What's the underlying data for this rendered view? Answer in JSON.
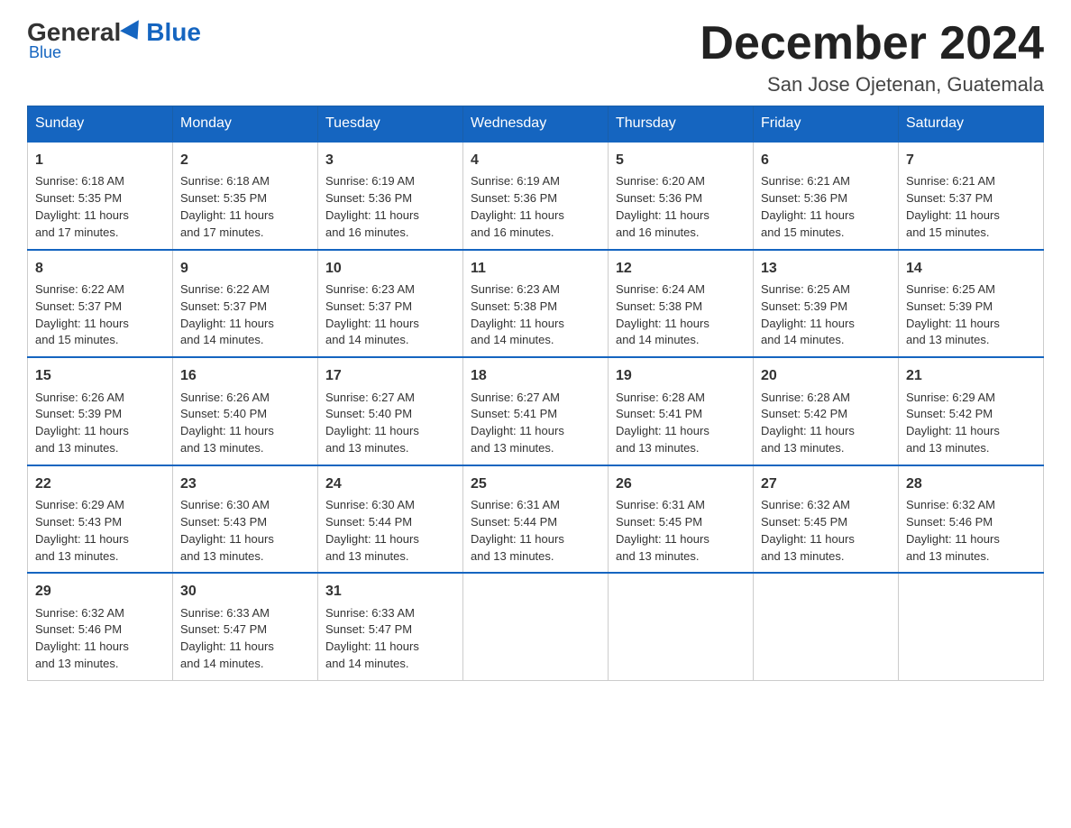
{
  "logo": {
    "general": "General",
    "blue": "Blue"
  },
  "title": "December 2024",
  "subtitle": "San Jose Ojetenan, Guatemala",
  "days": [
    "Sunday",
    "Monday",
    "Tuesday",
    "Wednesday",
    "Thursday",
    "Friday",
    "Saturday"
  ],
  "weeks": [
    [
      {
        "num": "1",
        "sunrise": "6:18 AM",
        "sunset": "5:35 PM",
        "daylight": "11 hours and 17 minutes."
      },
      {
        "num": "2",
        "sunrise": "6:18 AM",
        "sunset": "5:35 PM",
        "daylight": "11 hours and 17 minutes."
      },
      {
        "num": "3",
        "sunrise": "6:19 AM",
        "sunset": "5:36 PM",
        "daylight": "11 hours and 16 minutes."
      },
      {
        "num": "4",
        "sunrise": "6:19 AM",
        "sunset": "5:36 PM",
        "daylight": "11 hours and 16 minutes."
      },
      {
        "num": "5",
        "sunrise": "6:20 AM",
        "sunset": "5:36 PM",
        "daylight": "11 hours and 16 minutes."
      },
      {
        "num": "6",
        "sunrise": "6:21 AM",
        "sunset": "5:36 PM",
        "daylight": "11 hours and 15 minutes."
      },
      {
        "num": "7",
        "sunrise": "6:21 AM",
        "sunset": "5:37 PM",
        "daylight": "11 hours and 15 minutes."
      }
    ],
    [
      {
        "num": "8",
        "sunrise": "6:22 AM",
        "sunset": "5:37 PM",
        "daylight": "11 hours and 15 minutes."
      },
      {
        "num": "9",
        "sunrise": "6:22 AM",
        "sunset": "5:37 PM",
        "daylight": "11 hours and 14 minutes."
      },
      {
        "num": "10",
        "sunrise": "6:23 AM",
        "sunset": "5:37 PM",
        "daylight": "11 hours and 14 minutes."
      },
      {
        "num": "11",
        "sunrise": "6:23 AM",
        "sunset": "5:38 PM",
        "daylight": "11 hours and 14 minutes."
      },
      {
        "num": "12",
        "sunrise": "6:24 AM",
        "sunset": "5:38 PM",
        "daylight": "11 hours and 14 minutes."
      },
      {
        "num": "13",
        "sunrise": "6:25 AM",
        "sunset": "5:39 PM",
        "daylight": "11 hours and 14 minutes."
      },
      {
        "num": "14",
        "sunrise": "6:25 AM",
        "sunset": "5:39 PM",
        "daylight": "11 hours and 13 minutes."
      }
    ],
    [
      {
        "num": "15",
        "sunrise": "6:26 AM",
        "sunset": "5:39 PM",
        "daylight": "11 hours and 13 minutes."
      },
      {
        "num": "16",
        "sunrise": "6:26 AM",
        "sunset": "5:40 PM",
        "daylight": "11 hours and 13 minutes."
      },
      {
        "num": "17",
        "sunrise": "6:27 AM",
        "sunset": "5:40 PM",
        "daylight": "11 hours and 13 minutes."
      },
      {
        "num": "18",
        "sunrise": "6:27 AM",
        "sunset": "5:41 PM",
        "daylight": "11 hours and 13 minutes."
      },
      {
        "num": "19",
        "sunrise": "6:28 AM",
        "sunset": "5:41 PM",
        "daylight": "11 hours and 13 minutes."
      },
      {
        "num": "20",
        "sunrise": "6:28 AM",
        "sunset": "5:42 PM",
        "daylight": "11 hours and 13 minutes."
      },
      {
        "num": "21",
        "sunrise": "6:29 AM",
        "sunset": "5:42 PM",
        "daylight": "11 hours and 13 minutes."
      }
    ],
    [
      {
        "num": "22",
        "sunrise": "6:29 AM",
        "sunset": "5:43 PM",
        "daylight": "11 hours and 13 minutes."
      },
      {
        "num": "23",
        "sunrise": "6:30 AM",
        "sunset": "5:43 PM",
        "daylight": "11 hours and 13 minutes."
      },
      {
        "num": "24",
        "sunrise": "6:30 AM",
        "sunset": "5:44 PM",
        "daylight": "11 hours and 13 minutes."
      },
      {
        "num": "25",
        "sunrise": "6:31 AM",
        "sunset": "5:44 PM",
        "daylight": "11 hours and 13 minutes."
      },
      {
        "num": "26",
        "sunrise": "6:31 AM",
        "sunset": "5:45 PM",
        "daylight": "11 hours and 13 minutes."
      },
      {
        "num": "27",
        "sunrise": "6:32 AM",
        "sunset": "5:45 PM",
        "daylight": "11 hours and 13 minutes."
      },
      {
        "num": "28",
        "sunrise": "6:32 AM",
        "sunset": "5:46 PM",
        "daylight": "11 hours and 13 minutes."
      }
    ],
    [
      {
        "num": "29",
        "sunrise": "6:32 AM",
        "sunset": "5:46 PM",
        "daylight": "11 hours and 13 minutes."
      },
      {
        "num": "30",
        "sunrise": "6:33 AM",
        "sunset": "5:47 PM",
        "daylight": "11 hours and 14 minutes."
      },
      {
        "num": "31",
        "sunrise": "6:33 AM",
        "sunset": "5:47 PM",
        "daylight": "11 hours and 14 minutes."
      },
      null,
      null,
      null,
      null
    ]
  ],
  "labels": {
    "sunrise": "Sunrise:",
    "sunset": "Sunset:",
    "daylight": "Daylight:"
  }
}
